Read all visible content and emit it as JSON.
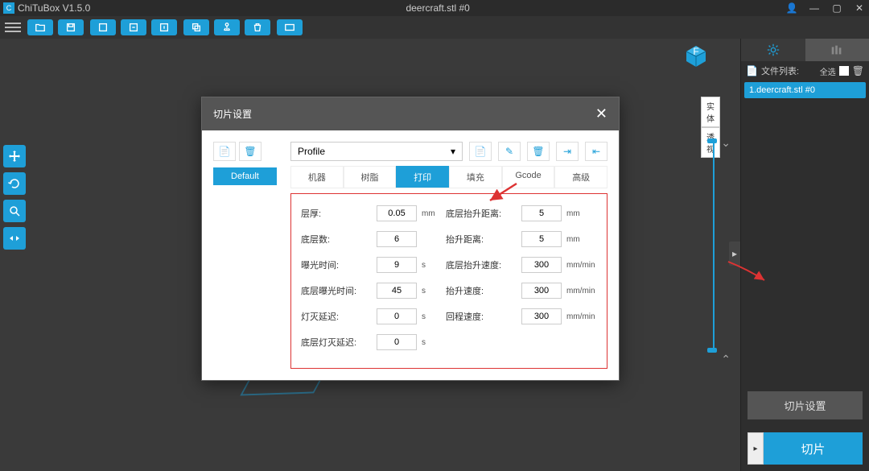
{
  "app": {
    "name": "ChiTuBox V1.5.0",
    "document": "deercraft.stl #0"
  },
  "window_controls": {
    "user": "👤",
    "min": "—",
    "max": "▢",
    "close": "✕"
  },
  "view_toggle": {
    "solid": "实体",
    "wire": "透视"
  },
  "sidebar": {
    "file_list_label": "文件列表:",
    "select_all": "全选",
    "files": [
      "1.deercraft.stl #0"
    ],
    "slice_settings": "切片设置",
    "slice": "切片",
    "expand": "▸"
  },
  "dialog": {
    "title": "切片设置",
    "profile_placeholder": "Profile",
    "default_btn": "Default",
    "tabs": [
      "机器",
      "树脂",
      "打印",
      "填充",
      "Gcode",
      "高级"
    ],
    "active_tab": 2,
    "params_left": [
      {
        "label": "层厚:",
        "value": "0.05",
        "unit": "mm"
      },
      {
        "label": "底层数:",
        "value": "6",
        "unit": ""
      },
      {
        "label": "曝光时间:",
        "value": "9",
        "unit": "s"
      },
      {
        "label": "底层曝光时间:",
        "value": "45",
        "unit": "s"
      },
      {
        "label": "灯灭延迟:",
        "value": "0",
        "unit": "s"
      },
      {
        "label": "底层灯灭延迟:",
        "value": "0",
        "unit": "s"
      }
    ],
    "params_right": [
      {
        "label": "底层抬升距离:",
        "value": "5",
        "unit": "mm"
      },
      {
        "label": "抬升距离:",
        "value": "5",
        "unit": "mm"
      },
      {
        "label": "底层抬升速度:",
        "value": "300",
        "unit": "mm/min"
      },
      {
        "label": "抬升速度:",
        "value": "300",
        "unit": "mm/min"
      },
      {
        "label": "回程速度:",
        "value": "300",
        "unit": "mm/min"
      }
    ]
  }
}
